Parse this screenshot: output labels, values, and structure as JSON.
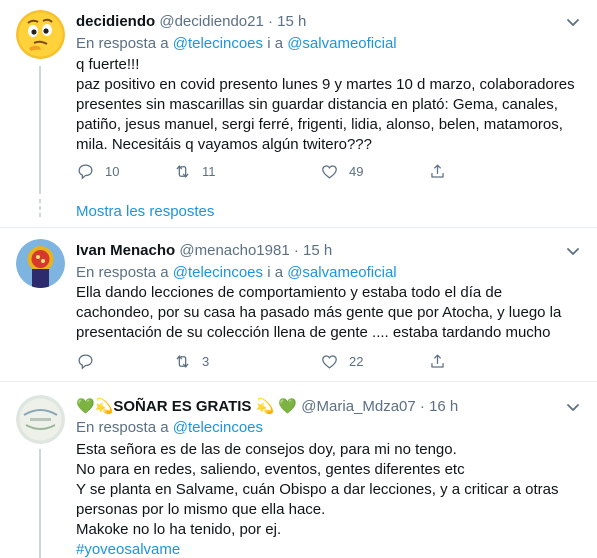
{
  "tweets": [
    {
      "name": "decidiendo",
      "handle": "@decidiendo21",
      "time": "· 15 h",
      "reply_prefix": "En resposta a",
      "reply_user1": "@telecincoes",
      "reply_join": "i a",
      "reply_user2": "@salvameoficial",
      "lines": [
        "q fuerte!!!",
        "paz positivo en covid presento lunes 9 y martes 10 d marzo, colaboradores presentes sin mascarillas sin guardar distancia en plató: Gema, canales, patiño, jesus manuel, sergi ferré, frigenti, lidia, alonso, belen, matamoros, mila. Necesitáis q vayamos algún twitero???"
      ],
      "replies": "10",
      "retweets": "11",
      "likes": "49",
      "show_more": "Mostra les respostes"
    },
    {
      "name": "Ivan Menacho",
      "handle": "@menacho1981",
      "time": "· 15 h",
      "reply_prefix": "En resposta a",
      "reply_user1": "@telecincoes",
      "reply_join": "i a",
      "reply_user2": "@salvameoficial",
      "lines": [
        "Ella dando lecciones de comportamiento y estaba todo el día de cachondeo, por su casa ha pasado más gente que por Atocha, y luego la presentación de su colección llena de gente .... estaba tardando mucho"
      ],
      "replies": "",
      "retweets": "3",
      "likes": "22"
    },
    {
      "name": "💚💫SOÑAR ES GRATIS 💫 💚",
      "handle": "@Maria_Mdza07",
      "time": "· 16 h",
      "reply_prefix": "En resposta a",
      "reply_user1": "@telecincoes",
      "lines": [
        "Esta señora es de las de consejos doy, para mi no tengo.",
        "No para en redes, saliendo, eventos, gentes diferentes etc",
        "Y se planta en Salvame, cuán Obispo a dar lecciones, y a criticar a otras personas por lo mismo que ella hace.",
        "Makoke no lo ha tenido, por ej."
      ],
      "hashtag": "#yoveosalvame"
    }
  ],
  "colors": {
    "text": "#0f1419",
    "secondary": "#5b7083",
    "link": "#1b95e0",
    "divider": "#e6ecf0"
  },
  "icons": [
    "emoji-avatar",
    "caret-down-icon",
    "reply-icon",
    "retweet-icon",
    "like-icon",
    "share-icon"
  ]
}
